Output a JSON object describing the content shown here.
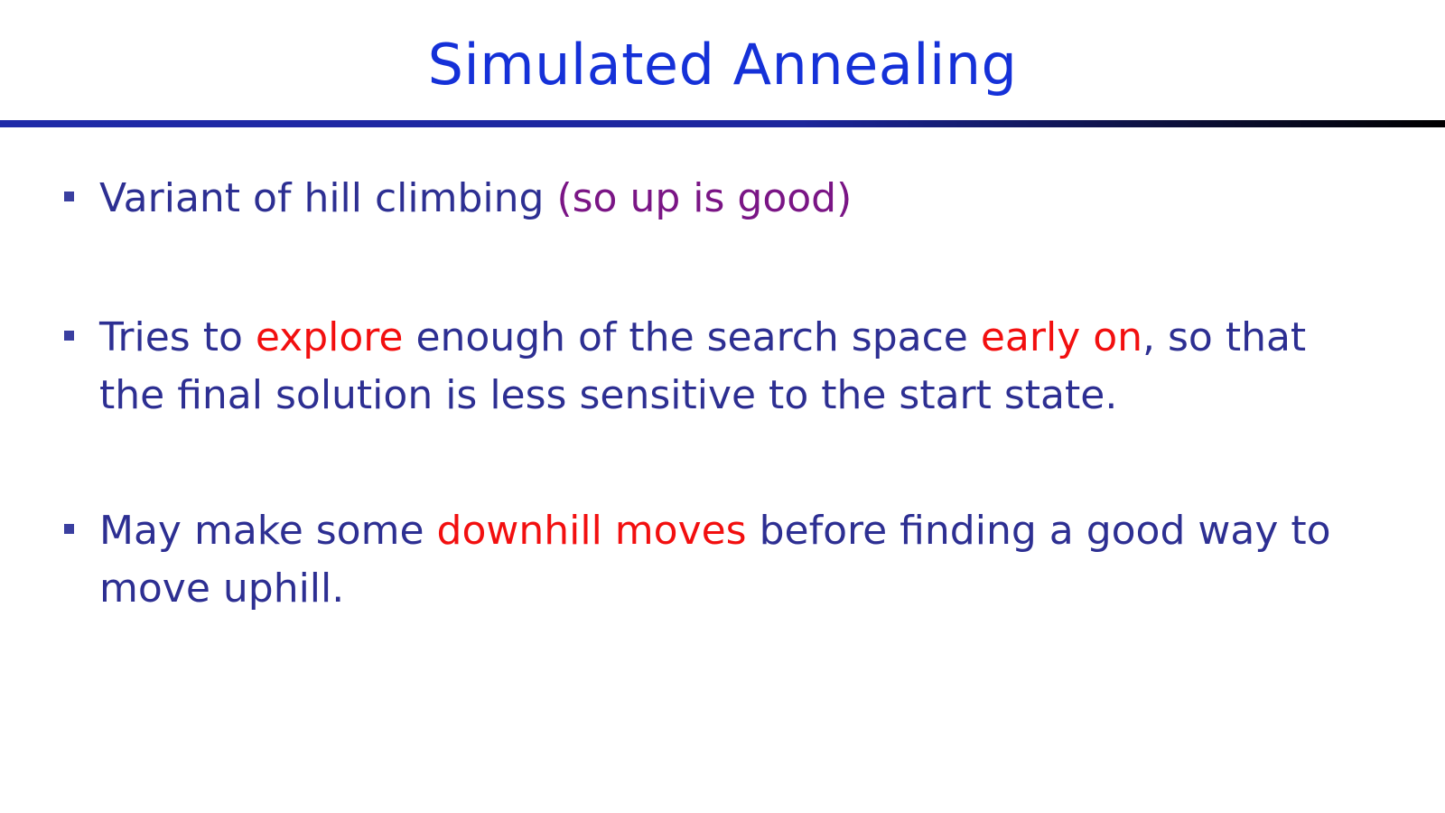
{
  "slide": {
    "title": "Simulated Annealing",
    "bullets": [
      {
        "segments": [
          {
            "text": "Variant of hill climbing ",
            "style": "plain"
          },
          {
            "text": "(so up is good)",
            "style": "purple"
          }
        ]
      },
      {
        "segments": [
          {
            "text": "Tries to ",
            "style": "plain"
          },
          {
            "text": "explore",
            "style": "red"
          },
          {
            "text": " enough of the search space ",
            "style": "plain"
          },
          {
            "text": "early on",
            "style": "red"
          },
          {
            "text": ", so that the final solution is less sensitive to the start state.",
            "style": "plain"
          }
        ]
      },
      {
        "segments": [
          {
            "text": "May make some ",
            "style": "plain"
          },
          {
            "text": "downhill moves",
            "style": "red"
          },
          {
            "text": " before finding a good way to move uphill.",
            "style": "plain"
          }
        ]
      }
    ]
  },
  "colors": {
    "title": "#1531d8",
    "body": "#2d2f92",
    "highlight_red": "#f20f0f",
    "highlight_purple": "#7a1585"
  },
  "icons": {
    "bullet_marker": "square-bullet-icon"
  }
}
